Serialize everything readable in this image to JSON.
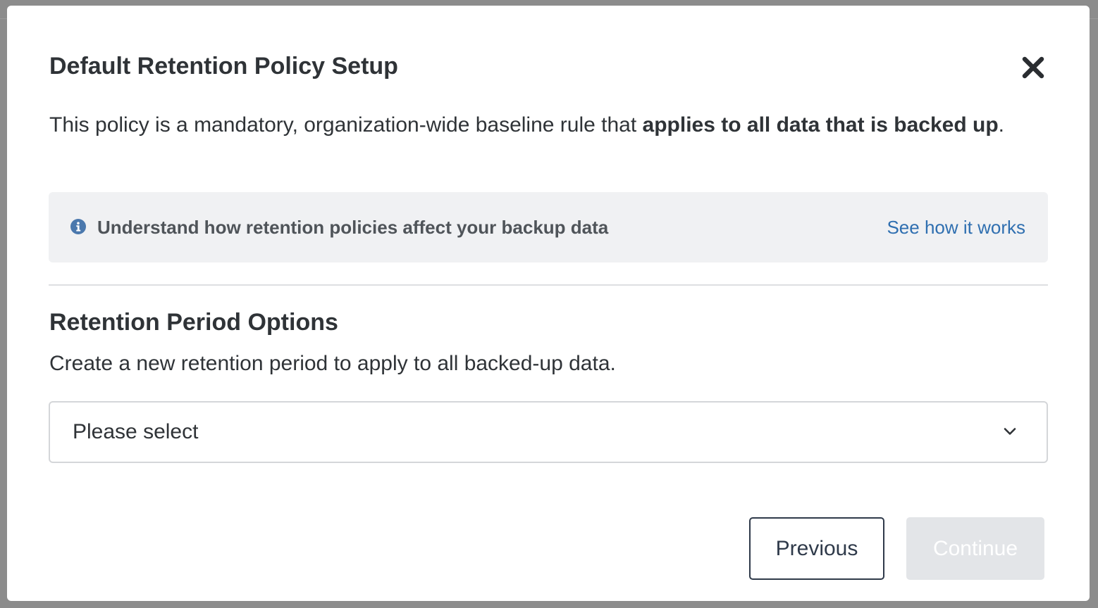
{
  "modal": {
    "title": "Default Retention Policy Setup",
    "close_icon": "close-icon",
    "intro": {
      "text_prefix": "This policy is a mandatory, organization-wide baseline rule that ",
      "text_bold": "applies to all data that is backed up",
      "text_suffix": "."
    },
    "info_box": {
      "icon": "info-circle-icon",
      "text": "Understand how retention policies affect your backup data",
      "link_label": "See how it works"
    },
    "section": {
      "title": "Retention Period Options",
      "description": "Create a new retention period to apply to all backed-up data.",
      "select": {
        "placeholder": "Please select",
        "icon": "chevron-down-icon"
      }
    },
    "footer": {
      "previous_label": "Previous",
      "continue_label": "Continue"
    }
  },
  "colors": {
    "text": "#2f3337",
    "link": "#2f6fb0",
    "info_icon": "#4a78ad",
    "info_bg": "#f0f1f3",
    "disabled_button_bg": "#e3e5e8",
    "backdrop": "#8c8c8c"
  }
}
